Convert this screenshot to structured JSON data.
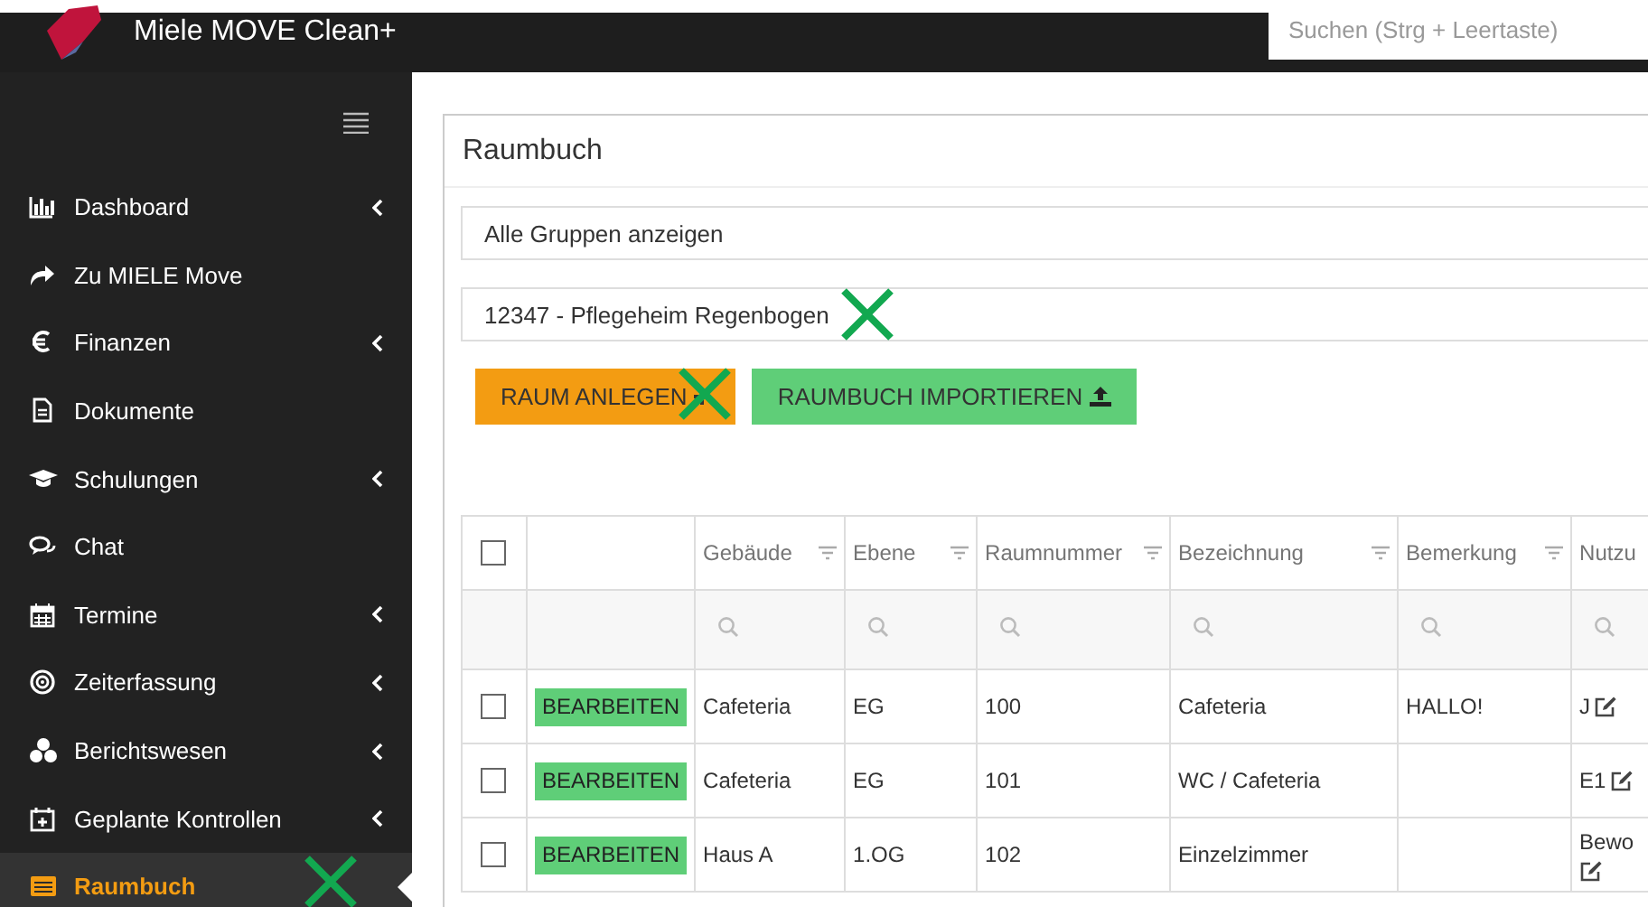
{
  "app": {
    "title": "Miele MOVE Clean+",
    "search": {
      "placeholder": "Suchen (Strg + Leertaste)"
    }
  },
  "sidebar": {
    "items": [
      {
        "label": "Dashboard",
        "has_submenu": true,
        "selected": false
      },
      {
        "label": "Zu MIELE Move",
        "has_submenu": false,
        "selected": false
      },
      {
        "label": "Finanzen",
        "has_submenu": true,
        "selected": false
      },
      {
        "label": "Dokumente",
        "has_submenu": false,
        "selected": false
      },
      {
        "label": "Schulungen",
        "has_submenu": true,
        "selected": false
      },
      {
        "label": "Chat",
        "has_submenu": false,
        "selected": false
      },
      {
        "label": "Termine",
        "has_submenu": true,
        "selected": false
      },
      {
        "label": "Zeiterfassung",
        "has_submenu": true,
        "selected": false
      },
      {
        "label": "Berichtswesen",
        "has_submenu": true,
        "selected": false
      },
      {
        "label": "Geplante Kontrollen",
        "has_submenu": true,
        "selected": false
      },
      {
        "label": "Raumbuch",
        "has_submenu": false,
        "selected": true
      }
    ]
  },
  "panel": {
    "title": "Raumbuch",
    "filters": [
      {
        "value": "Alle Gruppen anzeigen"
      },
      {
        "value": "12347 - Pflegeheim Regenbogen"
      }
    ],
    "buttons": [
      {
        "label": "RAUM ANLEGEN",
        "kind": "add"
      },
      {
        "label": "RAUMBUCH IMPORTIEREN",
        "kind": "import"
      }
    ],
    "table": {
      "select_all_checked": false,
      "columns": [
        {
          "label": "Gebäude"
        },
        {
          "label": "Ebene"
        },
        {
          "label": "Raumnummer"
        },
        {
          "label": "Bezeichnung"
        },
        {
          "label": "Bemerkung"
        },
        {
          "label": "Nutzu"
        }
      ],
      "rows": [
        {
          "checked": false,
          "action": "BEARBEITEN",
          "cells": [
            "Cafeteria",
            "EG",
            "100",
            "Cafeteria",
            "HALLO!",
            "J"
          ]
        },
        {
          "checked": false,
          "action": "BEARBEITEN",
          "cells": [
            "Cafeteria",
            "EG",
            "101",
            "WC / Cafeteria",
            "",
            "E1"
          ]
        },
        {
          "checked": false,
          "action": "BEARBEITEN",
          "cells": [
            "Haus A",
            "1.OG",
            "102",
            "Einzelzimmer",
            "",
            "Bewo"
          ]
        }
      ]
    }
  },
  "annotation_marks": [
    {
      "kind": "cross"
    },
    {
      "kind": "cross"
    },
    {
      "kind": "cross"
    }
  ]
}
